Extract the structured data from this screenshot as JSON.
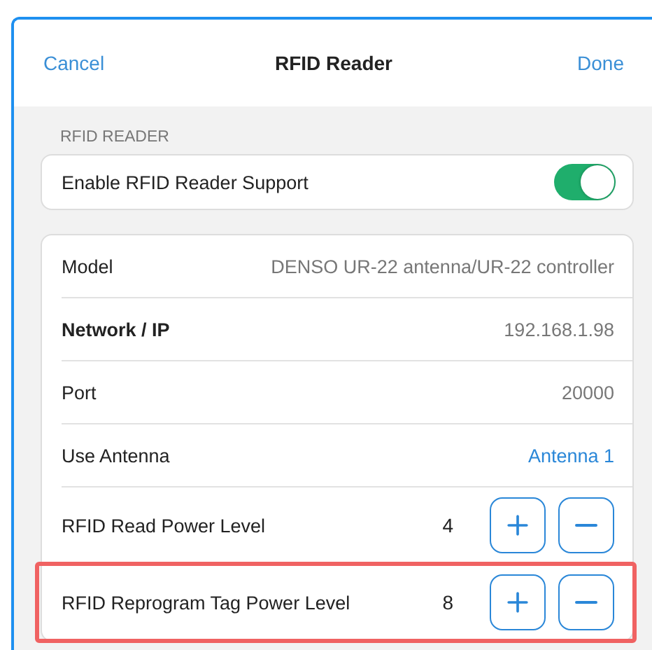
{
  "nav": {
    "cancel": "Cancel",
    "title": "RFID Reader",
    "done": "Done"
  },
  "section_header": "RFID READER",
  "toggle": {
    "label": "Enable RFID Reader Support",
    "on": true
  },
  "rows": [
    {
      "kind": "value",
      "label": "Model",
      "value": "DENSO UR-22 antenna/UR-22 controller",
      "bold": false,
      "highlighted": false
    },
    {
      "kind": "value",
      "label": "Network / IP",
      "value": "192.168.1.98",
      "bold": true,
      "highlighted": false
    },
    {
      "kind": "value",
      "label": "Port",
      "value": "20000",
      "bold": false,
      "highlighted": false
    },
    {
      "kind": "link",
      "label": "Use Antenna",
      "value": "Antenna 1",
      "bold": false,
      "highlighted": false
    },
    {
      "kind": "stepper",
      "label": "RFID Read Power Level",
      "value": "4",
      "bold": false,
      "highlighted": false
    },
    {
      "kind": "stepper",
      "label": "RFID Reprogram Tag Power Level",
      "value": "8",
      "bold": false,
      "highlighted": true
    }
  ]
}
